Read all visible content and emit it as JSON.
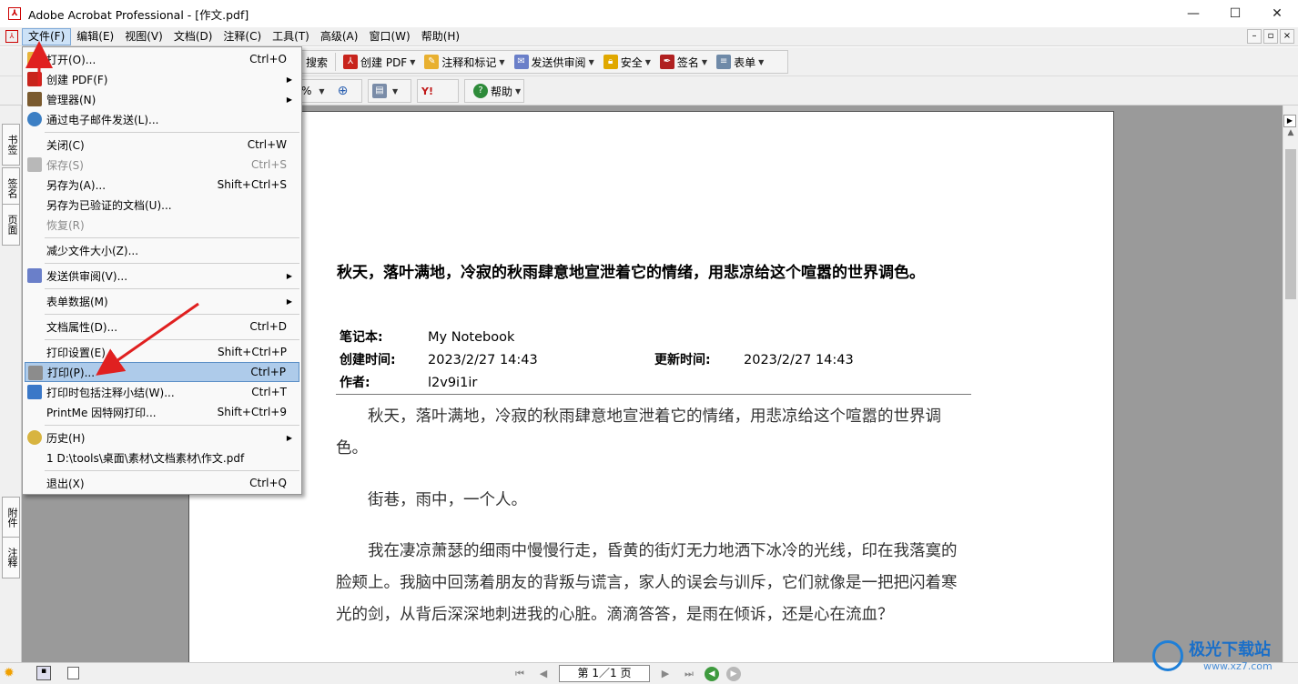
{
  "window": {
    "title": "Adobe Acrobat Professional - [作文.pdf]",
    "minimize": "—",
    "maximize": "☐",
    "close": "✕"
  },
  "menubar": {
    "items": [
      "文件(F)",
      "编辑(E)",
      "视图(V)",
      "文档(D)",
      "注释(C)",
      "工具(T)",
      "高级(A)",
      "窗口(W)",
      "帮助(H)"
    ],
    "mdi": [
      "–",
      "▫",
      "×"
    ]
  },
  "toolbar1": {
    "search": "搜索",
    "create_pdf": "创建 PDF",
    "comment": "注释和标记",
    "send_review": "发送供审阅",
    "secure": "安全",
    "sign": "签名",
    "forms": "表单"
  },
  "toolbar2": {
    "zoom_suffix": "%",
    "help": "帮助"
  },
  "left_tabs": [
    "书签",
    "签名",
    "页面",
    "附件",
    "注释"
  ],
  "file_menu": {
    "items": [
      {
        "label": "打开(O)...",
        "shortcut": "Ctrl+O",
        "icon": "open-folder-icon",
        "disabled": false,
        "submenu": false
      },
      {
        "label": "创建 PDF(F)",
        "shortcut": "",
        "icon": "create-pdf-icon",
        "disabled": false,
        "submenu": true
      },
      {
        "label": "管理器(N)",
        "shortcut": "",
        "icon": "organizer-icon",
        "disabled": false,
        "submenu": true
      },
      {
        "label": "通过电子邮件发送(L)...",
        "shortcut": "",
        "icon": "email-icon",
        "disabled": false,
        "submenu": false
      },
      {
        "label": "关闭(C)",
        "shortcut": "Ctrl+W",
        "icon": "",
        "disabled": false,
        "submenu": false
      },
      {
        "label": "保存(S)",
        "shortcut": "Ctrl+S",
        "icon": "save-icon",
        "disabled": true,
        "submenu": false
      },
      {
        "label": "另存为(A)...",
        "shortcut": "Shift+Ctrl+S",
        "icon": "",
        "disabled": false,
        "submenu": false
      },
      {
        "label": "另存为已验证的文档(U)...",
        "shortcut": "",
        "icon": "",
        "disabled": false,
        "submenu": false
      },
      {
        "label": "恢复(R)",
        "shortcut": "",
        "icon": "",
        "disabled": true,
        "submenu": false
      },
      {
        "label": "减少文件大小(Z)...",
        "shortcut": "",
        "icon": "",
        "disabled": false,
        "submenu": false
      },
      {
        "label": "发送供审阅(V)...",
        "shortcut": "",
        "icon": "send-review-icon",
        "disabled": false,
        "submenu": true
      },
      {
        "label": "表单数据(M)",
        "shortcut": "",
        "icon": "",
        "disabled": false,
        "submenu": true
      },
      {
        "label": "文档属性(D)...",
        "shortcut": "Ctrl+D",
        "icon": "",
        "disabled": false,
        "submenu": false
      },
      {
        "label": "打印设置(E)...",
        "shortcut": "Shift+Ctrl+P",
        "icon": "",
        "disabled": false,
        "submenu": false
      },
      {
        "label": "打印(P)...",
        "shortcut": "Ctrl+P",
        "icon": "printer-icon",
        "disabled": false,
        "submenu": false
      },
      {
        "label": "打印时包括注释小结(W)...",
        "shortcut": "Ctrl+T",
        "icon": "comment-summary-icon",
        "disabled": false,
        "submenu": false
      },
      {
        "label": "PrintMe 因特网打印...",
        "shortcut": "Shift+Ctrl+9",
        "icon": "",
        "disabled": false,
        "submenu": false
      },
      {
        "label": "历史(H)",
        "shortcut": "",
        "icon": "history-icon",
        "disabled": false,
        "submenu": true
      },
      {
        "label": "1 D:\\tools\\桌面\\素材\\文档素材\\作文.pdf",
        "shortcut": "",
        "icon": "",
        "disabled": false,
        "submenu": false
      },
      {
        "label": "退出(X)",
        "shortcut": "Ctrl+Q",
        "icon": "",
        "disabled": false,
        "submenu": false
      }
    ]
  },
  "document": {
    "title": "秋天，落叶满地，冷寂的秋雨肆意地宣泄着它的情绪，用悲凉给这个喧嚣的世界调色。",
    "notebook_key": "笔记本:",
    "notebook_val": "My Notebook",
    "created_key": "创建时间:",
    "created_val": "2023/2/27 14:43",
    "updated_key": "更新时间:",
    "updated_val": "2023/2/27 14:43",
    "author_key": "作者:",
    "author_val": "l2v9i1ir",
    "para1": "秋天，落叶满地，冷寂的秋雨肆意地宣泄着它的情绪，用悲凉给这个喧嚣的世界调色。",
    "para2": "街巷，雨中，一个人。",
    "para3": "我在凄凉萧瑟的细雨中慢慢行走，昏黄的街灯无力地洒下冰冷的光线，印在我落寞的脸颊上。我脑中回荡着朋友的背叛与谎言，家人的误会与训斥，它们就像是一把把闪着寒光的剑，从背后深深地刺进我的心脏。滴滴答答，是雨在倾诉，还是心在流血？"
  },
  "statusbar": {
    "page_indicator": "第 1／1 页"
  },
  "watermark": {
    "text": "极光下载站",
    "url": "www.xz7.com"
  },
  "colors": {
    "highlight": "#aecbea",
    "arrow": "#e02020",
    "doc_bg": "#9a9a9a"
  }
}
